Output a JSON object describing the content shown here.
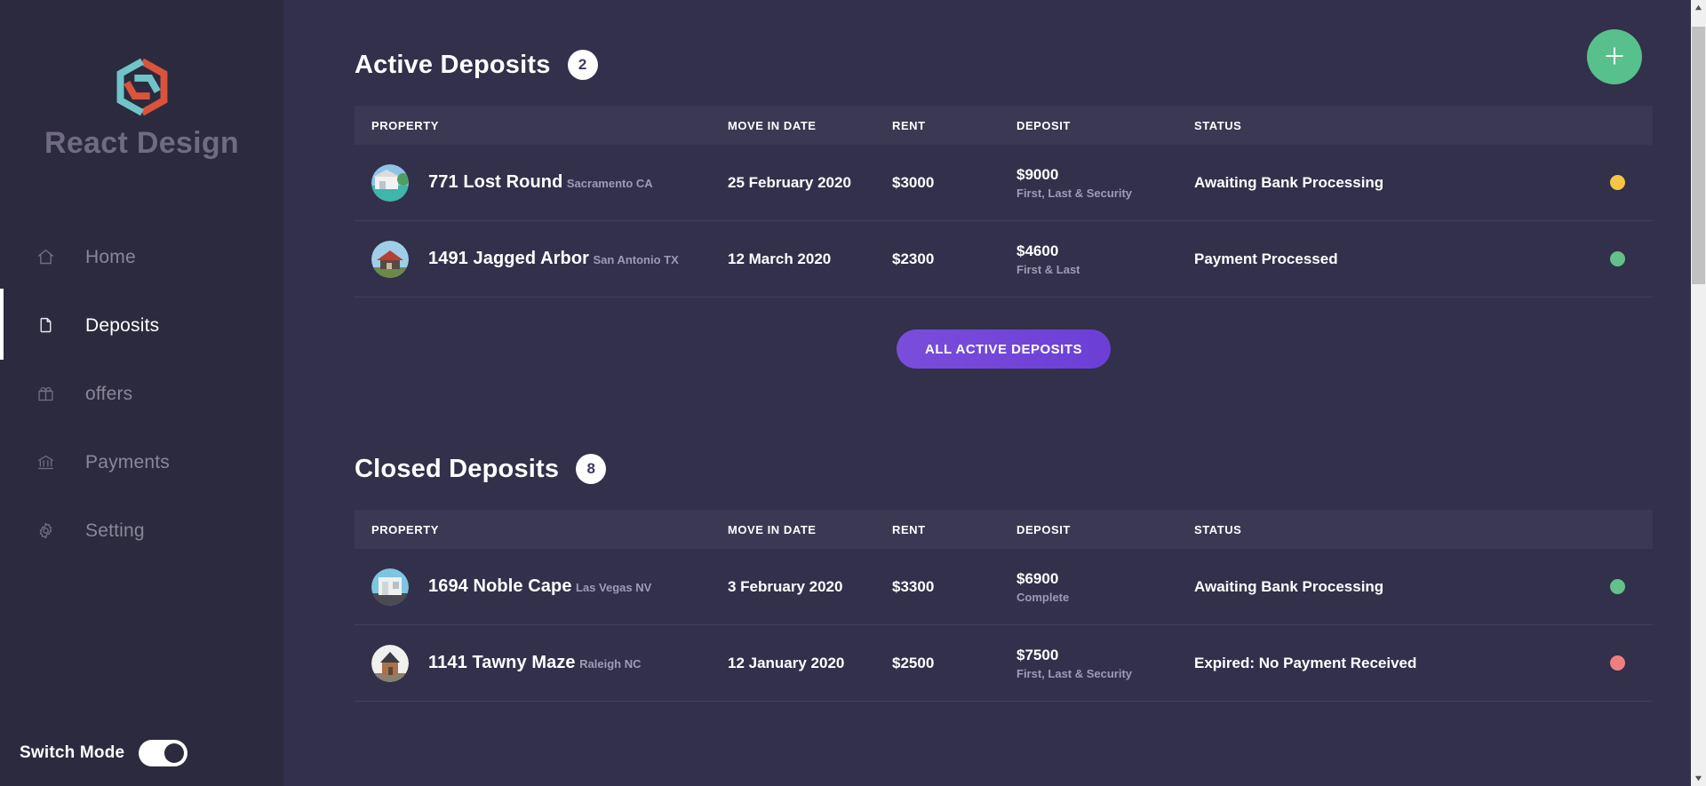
{
  "sidebar": {
    "logo": {
      "icon": "hexagon-logo-icon",
      "text": "React Design"
    },
    "items": [
      {
        "label": "Home",
        "icon": "home-icon",
        "active": false
      },
      {
        "label": "Deposits",
        "icon": "document-icon",
        "active": true
      },
      {
        "label": "offers",
        "icon": "gift-icon",
        "active": false
      },
      {
        "label": "Payments",
        "icon": "bank-icon",
        "active": false
      },
      {
        "label": "Setting",
        "icon": "gear-icon",
        "active": false
      }
    ],
    "switch": {
      "label": "Switch Mode",
      "state": "on"
    }
  },
  "main": {
    "add_button": {
      "icon": "plus-icon",
      "color": "#57c08d"
    },
    "columns": [
      "PROPERTY",
      "MOVE IN DATE",
      "RENT",
      "DEPOSIT",
      "STATUS"
    ],
    "active_section": {
      "title": "Active Deposits",
      "count": "2",
      "rows": [
        {
          "property": "771 Lost Round",
          "location": "Sacramento CA",
          "move_in_date": "25 February 2020",
          "rent": "$3000",
          "deposit": "$9000",
          "deposit_detail": "First, Last & Security",
          "status": "Awaiting Bank Processing",
          "status_color": "#f7c544",
          "avatar": "property-photo-modern-house"
        },
        {
          "property": "1491 Jagged Arbor",
          "location": "San Antonio TX",
          "move_in_date": "12 March 2020",
          "rent": "$2300",
          "deposit": "$4600",
          "deposit_detail": "First & Last",
          "status": "Payment Processed",
          "status_color": "#63c08a",
          "avatar": "property-photo-red-roof-house"
        }
      ],
      "button_label": "ALL ACTIVE DEPOSITS"
    },
    "closed_section": {
      "title": "Closed Deposits",
      "count": "8",
      "rows": [
        {
          "property": "1694 Noble Cape",
          "location": "Las Vegas NV",
          "move_in_date": "3 February 2020",
          "rent": "$3300",
          "deposit": "$6900",
          "deposit_detail": "Complete",
          "status": "Awaiting Bank Processing",
          "status_color": "#63c08a",
          "avatar": "property-photo-white-house"
        },
        {
          "property": "1141 Tawny Maze",
          "location": "Raleigh NC",
          "move_in_date": "12 January 2020",
          "rent": "$2500",
          "deposit": "$7500",
          "deposit_detail": "First, Last & Security",
          "status": "Expired: No Payment Received",
          "status_color": "#ef7f7f",
          "avatar": "property-photo-brick-house"
        }
      ]
    }
  },
  "theme": {
    "sidebar_bg": "#2c2a3e",
    "main_bg": "#32304a",
    "accent_purple": "#7b4ddb",
    "accent_green": "#57c08d"
  }
}
